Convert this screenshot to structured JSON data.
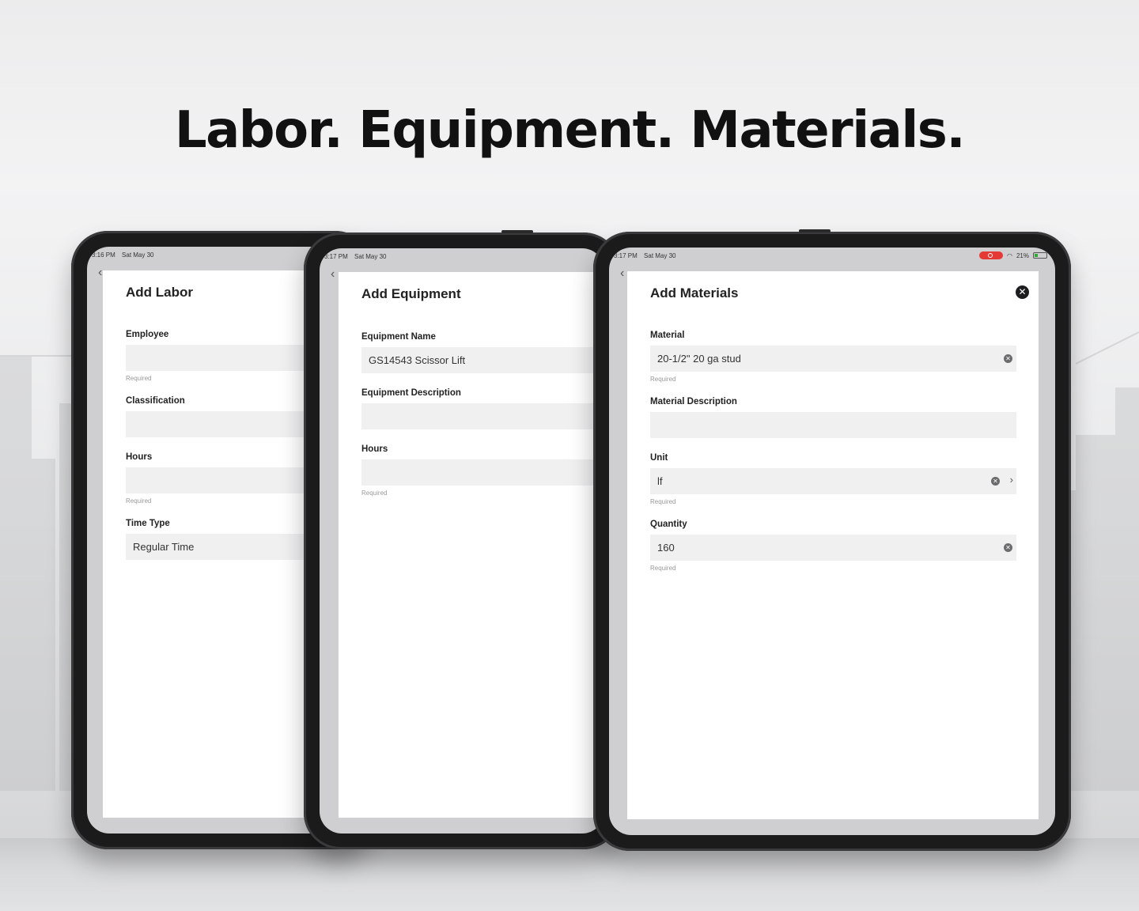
{
  "headline": "Labor. Equipment. Materials.",
  "tablets": {
    "labor": {
      "status_time": "3:16 PM",
      "status_date": "Sat May 30",
      "title": "Add Labor",
      "fields": {
        "employee": {
          "label": "Employee",
          "value": "",
          "helper": "Required"
        },
        "classification": {
          "label": "Classification",
          "value": ""
        },
        "hours": {
          "label": "Hours",
          "value": "",
          "helper": "Required"
        },
        "time_type": {
          "label": "Time Type",
          "value": "Regular Time"
        }
      }
    },
    "equipment": {
      "status_time": "3:17 PM",
      "status_date": "Sat May 30",
      "title": "Add Equipment",
      "fields": {
        "equipment_name": {
          "label": "Equipment Name",
          "value": "GS14543 Scissor Lift"
        },
        "equipment_description": {
          "label": "Equipment Description",
          "value": ""
        },
        "hours": {
          "label": "Hours",
          "value": "",
          "helper": "Required"
        }
      }
    },
    "materials": {
      "status_time": "3:17 PM",
      "status_date": "Sat May 30",
      "status_battery": "21%",
      "title": "Add Materials",
      "fields": {
        "material": {
          "label": "Material",
          "value": "20-1/2\" 20 ga stud",
          "helper": "Required"
        },
        "material_description": {
          "label": "Material Description",
          "value": ""
        },
        "unit": {
          "label": "Unit",
          "value": "lf",
          "helper": "Required"
        },
        "quantity": {
          "label": "Quantity",
          "value": "160",
          "helper": "Required"
        }
      }
    }
  },
  "icons": {
    "close": "close-icon",
    "clear": "clear-icon",
    "chevron": "chevron-right-icon",
    "back": "chevron-left-icon"
  },
  "colors": {
    "recording": "#e53935",
    "field_bg": "#f0f0f1",
    "bezel": "#1b1b1c"
  }
}
